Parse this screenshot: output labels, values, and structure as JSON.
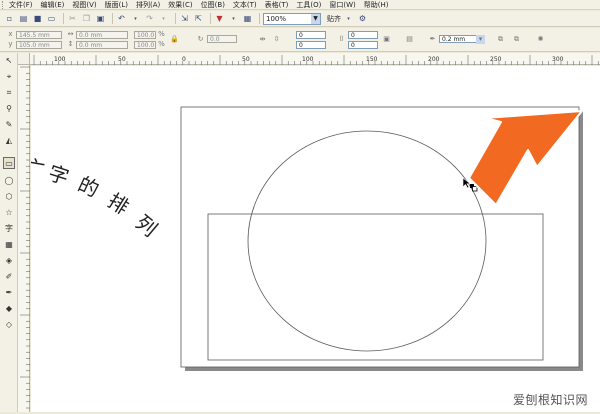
{
  "menu": [
    "文件(F)",
    "编辑(E)",
    "视图(V)",
    "版面(L)",
    "排列(A)",
    "效果(C)",
    "位图(B)",
    "文本(T)",
    "表格(T)",
    "工具(O)",
    "窗口(W)",
    "帮助(H)"
  ],
  "toolbar": {
    "zoom_value": "100%",
    "snap_label": "贴齐"
  },
  "property_bar": {
    "x": "145.5 mm",
    "y": "105.0 mm",
    "w": "0.0 mm",
    "h": "0.0 mm",
    "scale_x": "100.0",
    "scale_y": "100.0",
    "unit": "%",
    "rotation": "0.0",
    "corner_1": "0",
    "corner_2": "0",
    "corner_3": "0",
    "corner_4": "0",
    "outline_width": "0.2 mm"
  },
  "tools": [
    "pick-tool",
    "shape-tool",
    "crop-tool",
    "zoom-tool",
    "freehand-tool",
    "smart-fill-tool",
    "rectangle-tool",
    "ellipse-tool",
    "polygon-tool",
    "basic-shapes-tool",
    "text-tool",
    "table-tool",
    "interactive-blend-tool",
    "eyedropper-tool",
    "outline-tool",
    "fill-tool",
    "interactive-fill-tool"
  ],
  "tool_glyphs": [
    "↖",
    "⌖",
    "⌗",
    "⚲",
    "✎",
    "◭",
    "▭",
    "◯",
    "⬡",
    "☆",
    "字",
    "▦",
    "◈",
    "✐",
    "✒",
    "◆",
    "◇"
  ],
  "ruler_labels": [
    "100",
    "50",
    "0",
    "50",
    "100",
    "150",
    "200",
    "250",
    "300"
  ],
  "canvas": {
    "curved_text": "字的排列",
    "first_char_partial": "亠"
  },
  "watermark": "爱刨根知识网",
  "colors": {
    "arrow": "#f26a21",
    "page_shadow": "#8a8a8a"
  }
}
